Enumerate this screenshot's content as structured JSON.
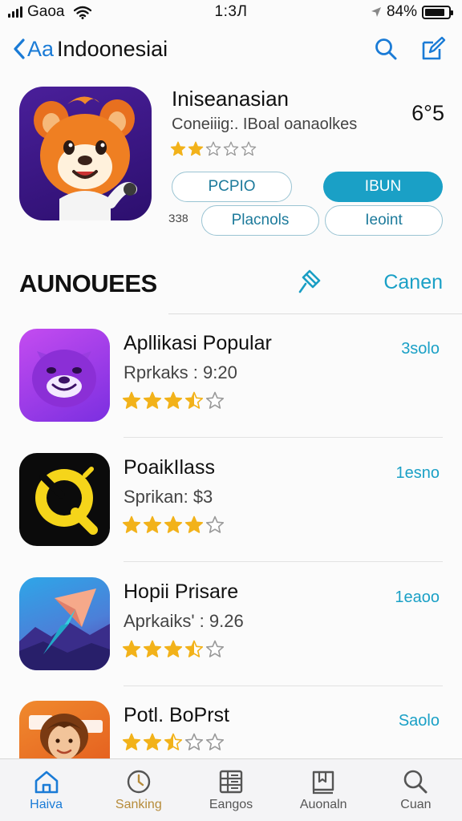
{
  "status_bar": {
    "carrier": "Gaoa",
    "time": "1:3Л",
    "battery_text": "84%",
    "battery_level": 0.84
  },
  "nav": {
    "back_label": "Aa",
    "title": "Indoonesiai",
    "icons": [
      "search-icon",
      "compose-icon"
    ]
  },
  "featured": {
    "name": "Iniseanasian",
    "subtitle": "Coneiiig:. IBoal oanaolkes",
    "size": "6°5",
    "rating": 2,
    "buttons": {
      "pill_1": "PCPIO",
      "pill_2": "IBUN",
      "pill_3": "Placnols",
      "pill_4": "Ieoint"
    },
    "row_label": "ЗЗ8"
  },
  "section": {
    "title": "AUNOUEES",
    "action": "Canen",
    "icon": "pin-icon"
  },
  "apps": [
    {
      "name": "Apllikasi Popular",
      "meta": "Rprkaks : 9:20",
      "action": "3solo",
      "rating": 3.5,
      "icon": "purple-bear"
    },
    {
      "name": "PoaikIlass",
      "meta": "Sprikan: $3",
      "action": "1esno",
      "rating": 4,
      "icon": "yellow-q"
    },
    {
      "name": "Hopii Prisare",
      "meta": "Aprkaiks' : 9.26",
      "action": "1eaoo",
      "rating": 3.5,
      "icon": "paper-plane"
    },
    {
      "name": "Potl. BoPrst",
      "meta": "",
      "action": "Saolo",
      "rating": 2.5,
      "icon": "woman-avatar"
    }
  ],
  "tabs": [
    {
      "label": "Haiva",
      "icon": "home-icon",
      "state": "active"
    },
    {
      "label": "Sanking",
      "icon": "clock-icon",
      "state": "highlight"
    },
    {
      "label": "Eangos",
      "icon": "grid-icon",
      "state": ""
    },
    {
      "label": "Auonaln",
      "icon": "book-icon",
      "state": ""
    },
    {
      "label": "Cuan",
      "icon": "search-icon",
      "state": ""
    }
  ],
  "colors": {
    "accent": "#1a7bd6",
    "teal": "#1aa0c6",
    "star": "#f2b21a"
  }
}
